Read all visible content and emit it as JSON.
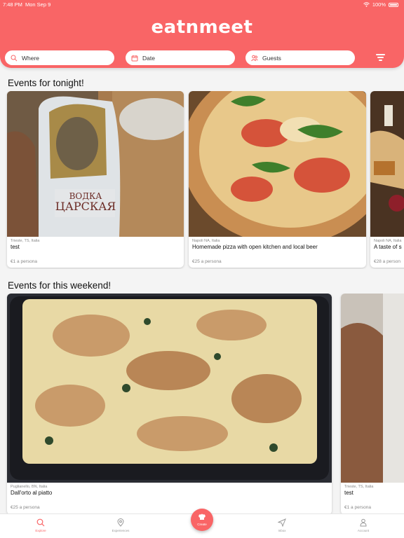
{
  "status_bar": {
    "time": "7:48 PM",
    "date": "Mon Sep 9",
    "battery": "100%"
  },
  "header": {
    "logo": "eatnmeet"
  },
  "search": {
    "where": "Where",
    "date": "Date",
    "guests": "Guests"
  },
  "sections": {
    "tonight": {
      "title": "Events for tonight!",
      "events": [
        {
          "location": "Trieste, TS, Italia",
          "title": "test",
          "price": "€1 a persona"
        },
        {
          "location": "Napoli NA, Italia",
          "title": "Homemade pizza with open kitchen and local beer",
          "price": "€25 a persona"
        },
        {
          "location": "Napoli NA, Italia",
          "title": "A taste of s",
          "price": "€28 a person"
        }
      ]
    },
    "weekend": {
      "title": "Events for this weekend!",
      "events": [
        {
          "location": "Puglianello, BN, Italia",
          "title": "Dall'orto al piatto",
          "price": "€25 a persona"
        },
        {
          "location": "Trieste, TS, Italia",
          "title": "test",
          "price": "€1 a persona"
        }
      ]
    }
  },
  "tabs": {
    "explore": "Explore",
    "experiences": "Experiences",
    "create": "Create",
    "inbox": "Inbox",
    "account": "Account"
  },
  "colors": {
    "brand": "#f96566"
  }
}
